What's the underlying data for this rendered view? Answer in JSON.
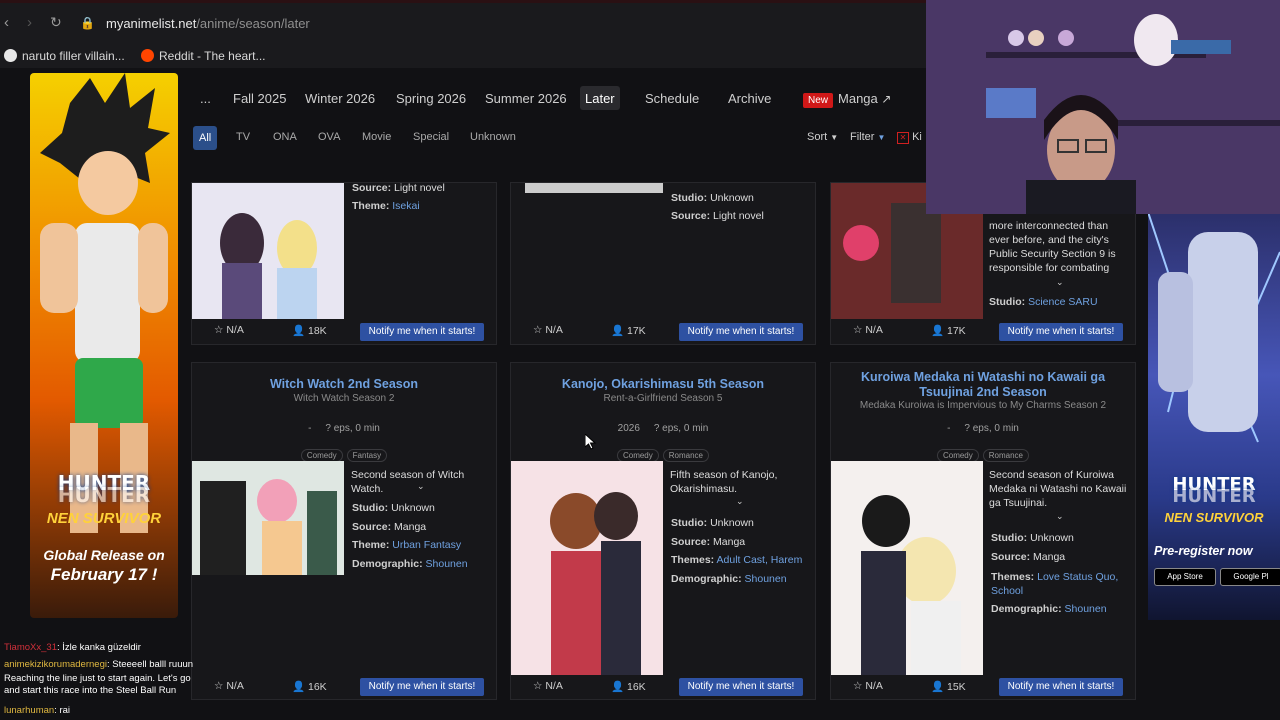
{
  "browser": {
    "url_host": "myanimelist.net",
    "url_path": "/anime/season/later",
    "bookmarks": [
      {
        "label": "naruto filler villain..."
      },
      {
        "label": "Reddit - The heart..."
      }
    ]
  },
  "nav": {
    "more": "...",
    "items": [
      "Fall 2025",
      "Winter 2026",
      "Spring 2026",
      "Summer 2026",
      "Later",
      "Schedule",
      "Archive"
    ],
    "new_badge": "New",
    "manga": "Manga"
  },
  "filters": {
    "types": [
      "All",
      "TV",
      "ONA",
      "OVA",
      "Movie",
      "Special",
      "Unknown"
    ],
    "sort": "Sort",
    "filter": "Filter",
    "kids": "Ki"
  },
  "top_row": [
    {
      "source_label": "Source:",
      "source": "Light novel",
      "theme_label": "Theme:",
      "theme": "Isekai",
      "score": "N/A",
      "members": "18K",
      "notify": "Notify me when it starts!"
    },
    {
      "studio_label": "Studio:",
      "studio": "Unknown",
      "source_label": "Source:",
      "source": "Light novel",
      "score": "N/A",
      "members": "17K",
      "notify": "Notify me when it starts!"
    },
    {
      "synopsis": "more interconnected than ever before, and the city's Public Security Section 9 is responsible for combating",
      "studio_label": "Studio:",
      "studio": "Science SARU",
      "score": "N/A",
      "members": "17K",
      "notify": "Notify me when it starts!"
    }
  ],
  "cards": [
    {
      "title": "Witch Watch 2nd Season",
      "alt_title": "Witch Watch Season 2",
      "date": "-",
      "eps": "? eps, 0 min",
      "genres": [
        "Comedy",
        "Fantasy"
      ],
      "synopsis": "Second season of Witch Watch.",
      "studio": "Unknown",
      "source": "Manga",
      "theme_label": "Theme:",
      "theme": "Urban Fantasy",
      "demographic": "Shounen",
      "score": "N/A",
      "members": "16K",
      "notify": "Notify me when it starts!"
    },
    {
      "title": "Kanojo, Okarishimasu 5th Season",
      "alt_title": "Rent-a-Girlfriend Season 5",
      "date": "2026",
      "eps": "? eps, 0 min",
      "genres": [
        "Comedy",
        "Romance"
      ],
      "synopsis": "Fifth season of Kanojo, Okarishimasu.",
      "studio": "Unknown",
      "source": "Manga",
      "theme_label": "Themes:",
      "theme": "Adult Cast, Harem",
      "demographic": "Shounen",
      "score": "N/A",
      "members": "16K",
      "notify": "Notify me when it starts!"
    },
    {
      "title": "Kuroiwa Medaka ni Watashi no Kawaii ga Tsuujinai 2nd Season",
      "alt_title": "Medaka Kuroiwa is Impervious to My Charms Season 2",
      "date": "-",
      "eps": "? eps, 0 min",
      "genres": [
        "Comedy",
        "Romance"
      ],
      "synopsis": "Second season of Kuroiwa Medaka ni Watashi no Kawaii ga Tsuujinai.",
      "studio": "Unknown",
      "source": "Manga",
      "theme_label": "Themes:",
      "theme": "Love Status Quo, School",
      "demographic": "Shounen",
      "score": "N/A",
      "members": "15K",
      "notify": "Notify me when it starts!"
    }
  ],
  "labels": {
    "studio": "Studio:",
    "source": "Source:",
    "demographic": "Demographic:"
  },
  "ads": {
    "left_title_1": "HUNTER",
    "left_title_2": "HUNTER",
    "left_sub_1": "NEN SURVIVOR",
    "left_tagline_1": "Global Release on",
    "left_tagline_2": "February 17 !",
    "right_title_1": "HUNTER",
    "right_title_2": "HUNTER",
    "right_sub_1": "NEN SURVIVOR",
    "right_tagline": "Pre-register now",
    "app_store": "App Store",
    "google_play": "Google Pl"
  },
  "chat": [
    {
      "user": "TiamoXx_31",
      "msg": ": İzle kanka güzeldir"
    },
    {
      "user": "animekizikorumadernegi",
      "msg": ": Steeeell balll ruuun"
    },
    {
      "user": "",
      "msg": "Reaching the line just to start again. Let's go and start this race into the Steel Ball Run"
    },
    {
      "user": "lunarhuman",
      "msg": ": rai"
    }
  ],
  "colors": {
    "accent": "#2e51a2",
    "link": "#6fa1e0",
    "active_filter": "#2b4f8a",
    "new_badge": "#d01818"
  }
}
